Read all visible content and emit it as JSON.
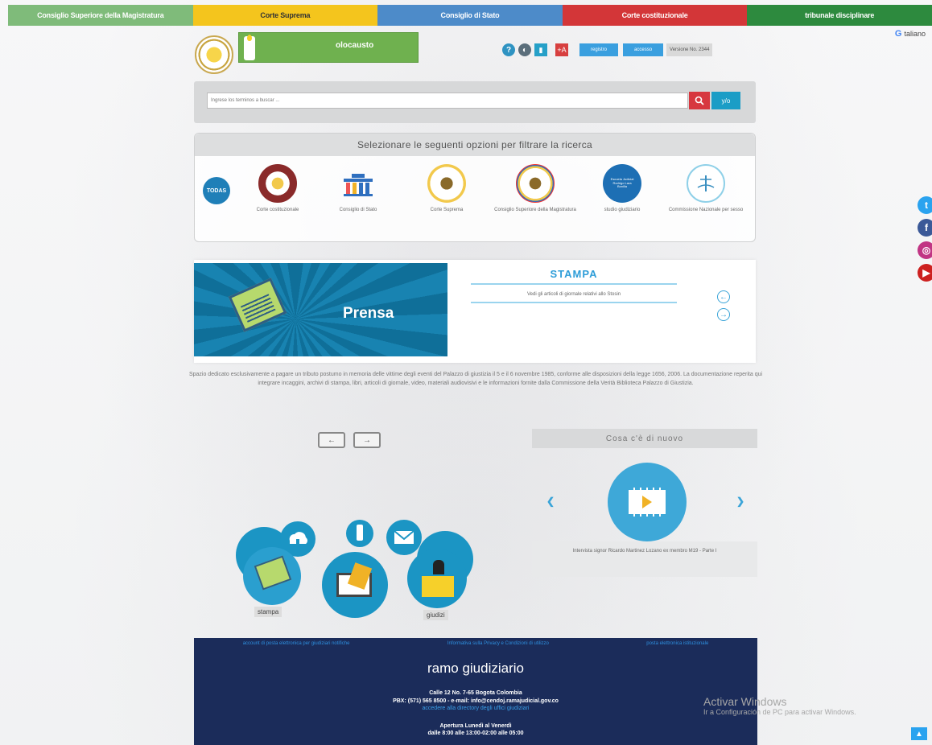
{
  "topnav": [
    "Consiglio Superiore della Magistratura",
    "Corte Suprema",
    "Consiglio di Stato",
    "Corte costituzionale",
    "tribunale disciplinare"
  ],
  "lang": {
    "label": "taliano"
  },
  "header": {
    "banner_text": "olocausto",
    "tools": {
      "help": "?",
      "audio": "◐",
      "contrast": "▮",
      "font": "+A"
    },
    "register_btn": "registro",
    "access_btn": "accesso",
    "version": "Versione No. 2344"
  },
  "search": {
    "placeholder": "Ingrese los terminos a buscar ...",
    "yo_btn": "y/o"
  },
  "filter": {
    "title": "Selezionare le seguenti opzioni per filtrare la ricerca",
    "todas": "TODAS",
    "items": [
      "Corte costituzionale",
      "Consiglio di Stato",
      "Corte Suprema",
      "Consiglio Superiore della Magistratura",
      "studio giudiziario",
      "Commissione Nazionale per sesso"
    ],
    "escuela_text": "Escuela Judicial Rodrigo Lara Bonilla"
  },
  "media": {
    "image_text": "Prensa",
    "title": "STAMPA",
    "desc": "Vedi gli articoli di giornale relativi allo Stosin"
  },
  "description": "Spazio dedicato esclusivamente a pagare un tributo postumo in memoria delle vittime degli eventi del Palazzo di giustizia il 5 e il 6 novembre 1985, conforme alle disposizioni della legge 1656, 2006. La documentazione reperita qui integrare incaggini, archivi di stampa, libri, articoli di giornale, video, materiali audiovisivi e le informazioni fornite dalla Commissione della Verità Biblioteca Palazzo di Giustizia.",
  "pager": {
    "prev": "←",
    "next": "→"
  },
  "news": {
    "title": "Cosa c'è di nuovo",
    "caption": "Intervista signor Ricardo Martinez Lozano ex membro M19 - Parte I"
  },
  "cluster": {
    "stampa": "stampa",
    "giudizi": "giudizi"
  },
  "footer": {
    "links": [
      "account di posta elettronica per giudiziari notifiche",
      "Informativa sulla Privacy e Condizioni di utilizzo",
      "posta elettronica istituzionale"
    ],
    "title": "ramo giudiziario",
    "address": "Calle 12 No. 7-65 Bogota Colombia",
    "phone": "PBX: (571) 565 8500 - e-mail: info@cendoj.ramajudicial.gov.co",
    "directory": "accedere alla directory degli uffici giudiziari",
    "hours_1": "Apertura Lunedì al Venerdì",
    "hours_2": "dalle 8:00 alle 13:00-02:00 alle 05:00"
  },
  "watermark": {
    "line1": "Activar Windows",
    "line2": "Ir a Configuración de PC para activar Windows."
  },
  "colors": {
    "nav1": "#7fbb7a",
    "nav2": "#f4c51d",
    "nav3": "#4d8bc9",
    "nav4": "#d33638",
    "nav5": "#2d8a3e",
    "footer": "#1b2c5a",
    "accent": "#1b95c4"
  }
}
